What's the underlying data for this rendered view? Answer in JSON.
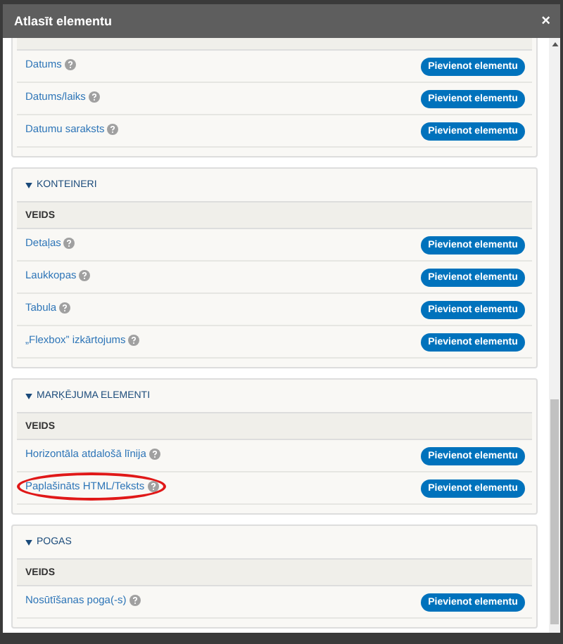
{
  "window": {
    "title": "Atlasīt elementu",
    "close": "×"
  },
  "sections": [
    {
      "items": [
        {
          "label": "Datums",
          "highlighted": false,
          "button": "Pievienot elementu"
        },
        {
          "label": "Datums/laiks",
          "highlighted": false,
          "button": "Pievienot elementu"
        },
        {
          "label": "Datumu saraksts",
          "highlighted": false,
          "button": "Pievienot elementu"
        }
      ]
    },
    {
      "title": "KONTEINERI",
      "column_header": "VEIDS",
      "items": [
        {
          "label": "Detaļas",
          "highlighted": false,
          "button": "Pievienot elementu"
        },
        {
          "label": "Laukkopas",
          "highlighted": false,
          "button": "Pievienot elementu"
        },
        {
          "label": "Tabula",
          "highlighted": false,
          "button": "Pievienot elementu"
        },
        {
          "label": "„Flexbox” izkārtojums",
          "highlighted": false,
          "button": "Pievienot elementu"
        }
      ]
    },
    {
      "title": "MARĶĒJUMA ELEMENTI",
      "column_header": "VEIDS",
      "items": [
        {
          "label": "Horizontāla atdalošā līnija",
          "highlighted": false,
          "button": "Pievienot elementu"
        },
        {
          "label": "Paplašināts HTML/Teksts",
          "highlighted": true,
          "button": "Pievienot elementu"
        }
      ]
    },
    {
      "title": "POGAS",
      "column_header": "VEIDS",
      "items": [
        {
          "label": "Nosūtīšanas poga(-s)",
          "highlighted": false,
          "button": "Pievienot elementu"
        }
      ]
    }
  ]
}
